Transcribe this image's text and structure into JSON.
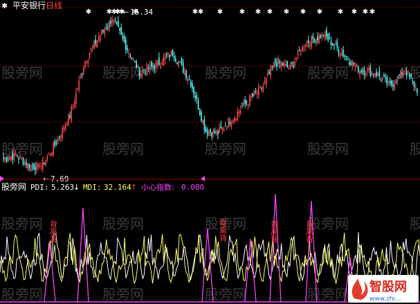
{
  "header": {
    "stock_name": "平安银行",
    "period": "日线",
    "prefix_icon": "star-marker-icon"
  },
  "price_panel": {
    "high_label": "15.34",
    "low_label": "7.69",
    "high_arrow": "←",
    "low_arrow": "←",
    "top_markers": "✱",
    "colors": {
      "up": "#ff4a4a",
      "down": "#54ffff",
      "grid": "#8b0000"
    }
  },
  "indicator_panel": {
    "name": "股旁网",
    "pdi_label": "PDI:",
    "pdi_value": "5.263",
    "pdi_arrow": "↓",
    "mdi_label": "MDI:",
    "mdi_value": "32.164",
    "mdi_arrow": "↑",
    "xin_label": "小心指数:",
    "xin_value": "0.000",
    "divergence_text": "背离背",
    "colors": {
      "pdi": "#ffffff",
      "mdi": "#ffff66",
      "xin": "#ff44ff"
    }
  },
  "watermark": "股旁网",
  "logo": {
    "name": "智股网",
    "url_text": "www.zhi..."
  },
  "chart_data": {
    "type": "candlestick",
    "title": "",
    "price_high": 15.34,
    "price_low": 7.69,
    "trend_pivots": [
      [
        0,
        8.2
      ],
      [
        8,
        8.4
      ],
      [
        16,
        7.9
      ],
      [
        24,
        7.7
      ],
      [
        34,
        8.9
      ],
      [
        44,
        10.4
      ],
      [
        54,
        13.2
      ],
      [
        64,
        14.5
      ],
      [
        72,
        15.3
      ],
      [
        82,
        13.8
      ],
      [
        90,
        12.6
      ],
      [
        100,
        12.9
      ],
      [
        112,
        13.6
      ],
      [
        124,
        12.1
      ],
      [
        134,
        9.6
      ],
      [
        142,
        9.5
      ],
      [
        152,
        10.3
      ],
      [
        164,
        11.3
      ],
      [
        172,
        11.9
      ],
      [
        180,
        13.1
      ],
      [
        190,
        12.8
      ],
      [
        200,
        14.1
      ],
      [
        212,
        14.5
      ],
      [
        224,
        13.6
      ],
      [
        236,
        12.7
      ],
      [
        246,
        12.6
      ],
      [
        256,
        11.9
      ],
      [
        266,
        12.7
      ],
      [
        274,
        11.7
      ]
    ],
    "indicator_series": [
      {
        "name": "PDI",
        "values": [
          5.3
        ]
      },
      {
        "name": "MDI",
        "values": [
          32.2
        ]
      },
      {
        "name": "小心指数",
        "values": [
          0.0
        ]
      }
    ]
  }
}
